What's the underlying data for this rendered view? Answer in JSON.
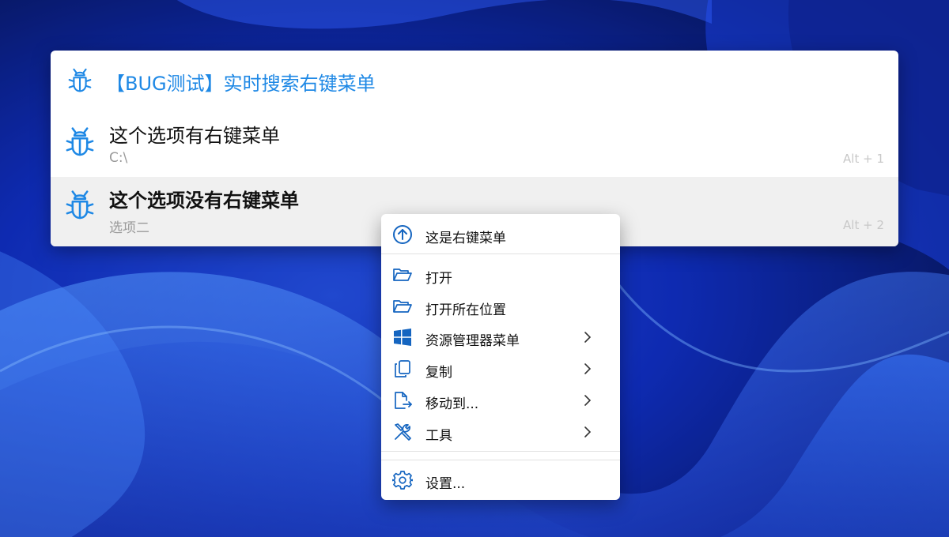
{
  "launcher": {
    "query": "【BUG测试】实时搜索右键菜单",
    "results": [
      {
        "title": "这个选项有右键菜单",
        "subtitle": "C:\\",
        "hotkey": "Alt + 1"
      },
      {
        "title": "这个选项没有右键菜单",
        "subtitle": "选项二",
        "hotkey": "Alt + 2"
      }
    ],
    "accent_color": "#1e88e5",
    "icon": "bug-icon"
  },
  "context_menu": {
    "header": {
      "label": "这是右键菜单",
      "icon": "arrow-up-circle-icon"
    },
    "items": [
      {
        "label": "打开",
        "icon": "folder-open-icon",
        "submenu": false
      },
      {
        "label": "打开所在位置",
        "icon": "folder-open-icon",
        "submenu": false
      },
      {
        "label": "资源管理器菜单",
        "icon": "windows-logo-icon",
        "submenu": true
      },
      {
        "label": "复制",
        "icon": "copy-icon",
        "submenu": true
      },
      {
        "label": "移动到...",
        "icon": "file-move-icon",
        "submenu": true
      },
      {
        "label": "工具",
        "icon": "tools-icon",
        "submenu": true
      }
    ],
    "footer": {
      "label": "设置...",
      "icon": "gear-icon"
    }
  }
}
